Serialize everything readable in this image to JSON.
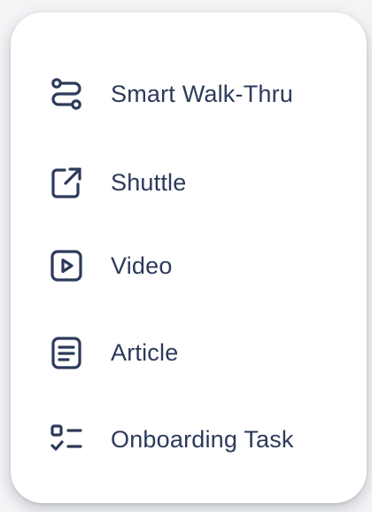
{
  "colors": {
    "text": "#2c3a5a",
    "icon": "#2c3a5a",
    "card_background": "#ffffff"
  },
  "menu": {
    "items": [
      {
        "label": "Smart Walk-Thru",
        "icon": "route-icon"
      },
      {
        "label": "Shuttle",
        "icon": "external-link-icon"
      },
      {
        "label": "Video",
        "icon": "play-icon"
      },
      {
        "label": "Article",
        "icon": "document-icon"
      },
      {
        "label": "Onboarding Task",
        "icon": "checklist-icon"
      }
    ]
  }
}
